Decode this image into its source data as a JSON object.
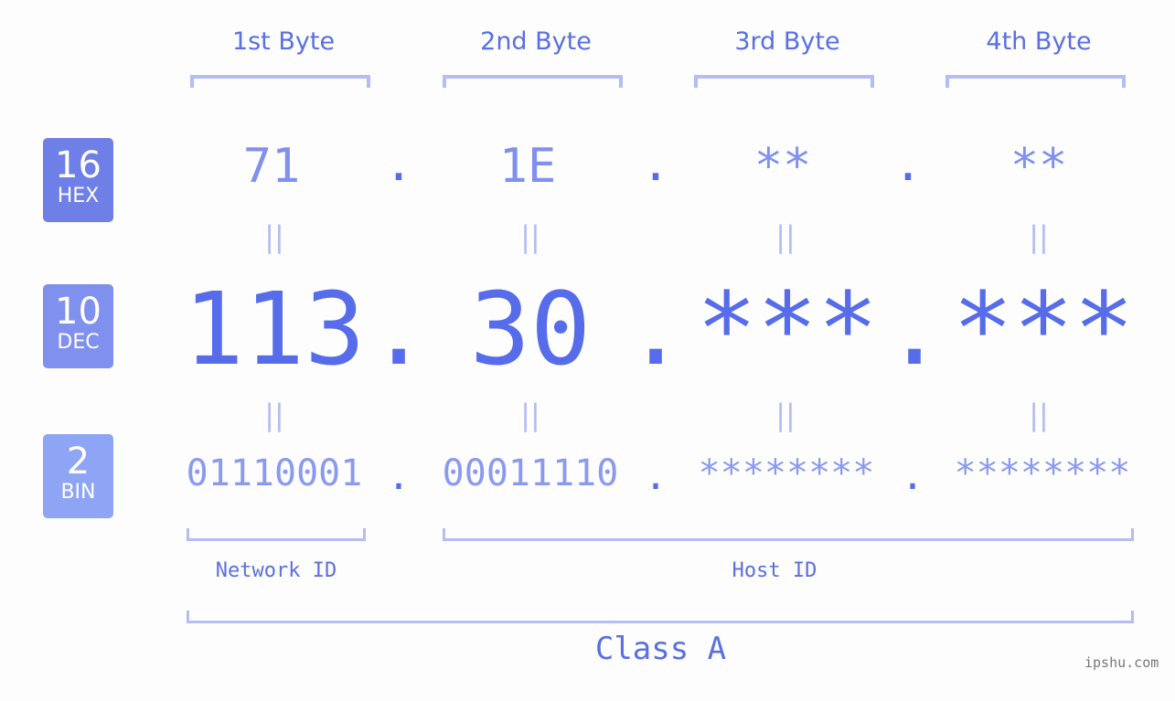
{
  "bytes": [
    {
      "label": "1st Byte",
      "hex": "71",
      "dec": "113",
      "bin": "01110001"
    },
    {
      "label": "2nd Byte",
      "hex": "1E",
      "dec": "30",
      "bin": "00011110"
    },
    {
      "label": "3rd Byte",
      "hex": "**",
      "dec": "***",
      "bin": "********"
    },
    {
      "label": "4th Byte",
      "hex": "**",
      "dec": "***",
      "bin": "********"
    }
  ],
  "badges": {
    "hex": {
      "num": "16",
      "label": "HEX",
      "color": "#6e7fe8"
    },
    "dec": {
      "num": "10",
      "label": "DEC",
      "color": "#8090ee"
    },
    "bin": {
      "num": "2",
      "label": "BIN",
      "color": "#8ea5f6"
    }
  },
  "separator": ".",
  "equals": "=",
  "network_id_label": "Network ID",
  "host_id_label": "Host ID",
  "class_label": "Class A",
  "watermark": "ipshu.com",
  "colors": {
    "accent": "#576ceb",
    "bracket": "#b3bdf6",
    "hex_text": "#8090ee",
    "bin_text": "#8a9af0"
  }
}
